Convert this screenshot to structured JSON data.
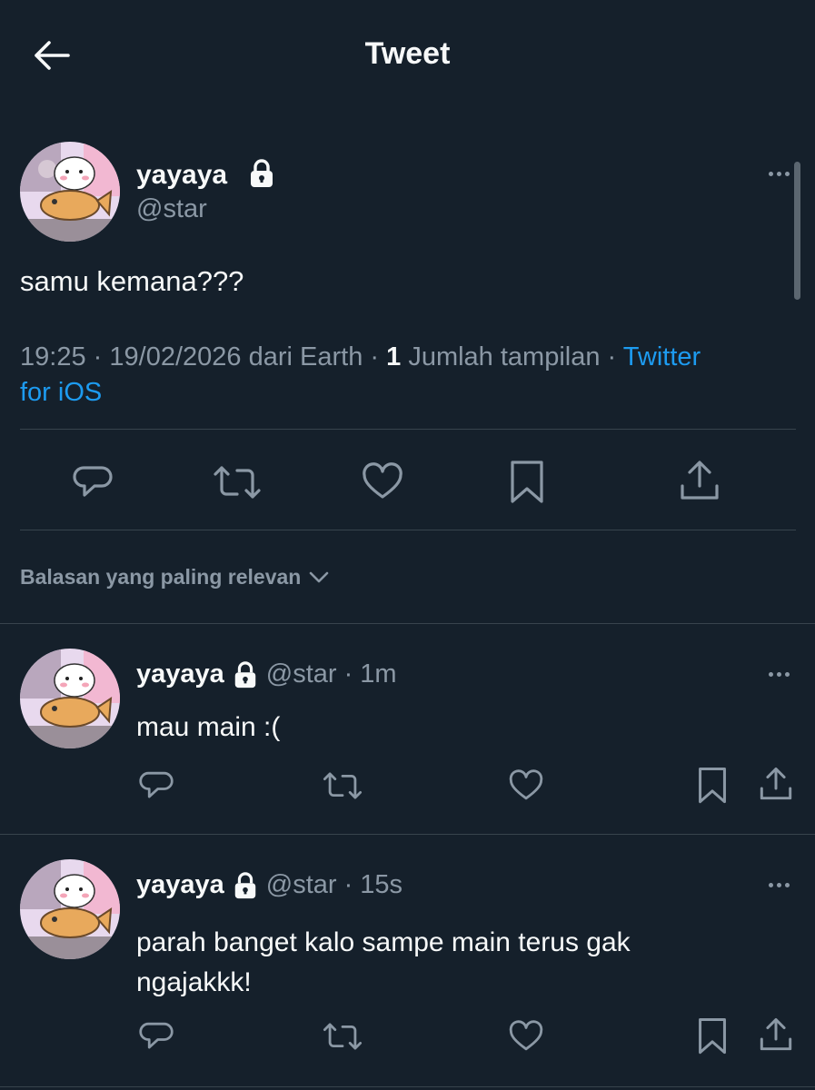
{
  "header": {
    "title": "Tweet",
    "back_icon": "arrow-left-icon"
  },
  "main_tweet": {
    "display_name": "yayaya",
    "handle": "@star",
    "text": "samu kemana???",
    "time": "19:25",
    "date": "19/02/2026",
    "location": "dari Earth",
    "views_count": "1",
    "views_label": "Jumlah tampilan",
    "source_part1": "Twitter",
    "source_part2": "for iOS",
    "separator": "·"
  },
  "replies_sort": {
    "label": "Balasan yang paling relevan",
    "icon": "chevron-down-icon"
  },
  "replies": [
    {
      "display_name": "yayaya",
      "handle": "@star",
      "time": "1m",
      "text": "mau main :("
    },
    {
      "display_name": "yayaya",
      "handle": "@star",
      "time": "15s",
      "text_line1": "parah banget kalo sampe main terus gak",
      "text_line2": "ngajakkk!"
    }
  ],
  "colors": {
    "background": "#15202b",
    "text": "#f7f9f9",
    "muted": "#8b98a5",
    "link": "#1d9bf0",
    "divider": "#38444d"
  },
  "icons": [
    "reply-icon",
    "retweet-icon",
    "like-icon",
    "bookmark-icon",
    "share-icon",
    "lock-icon",
    "more-icon"
  ]
}
